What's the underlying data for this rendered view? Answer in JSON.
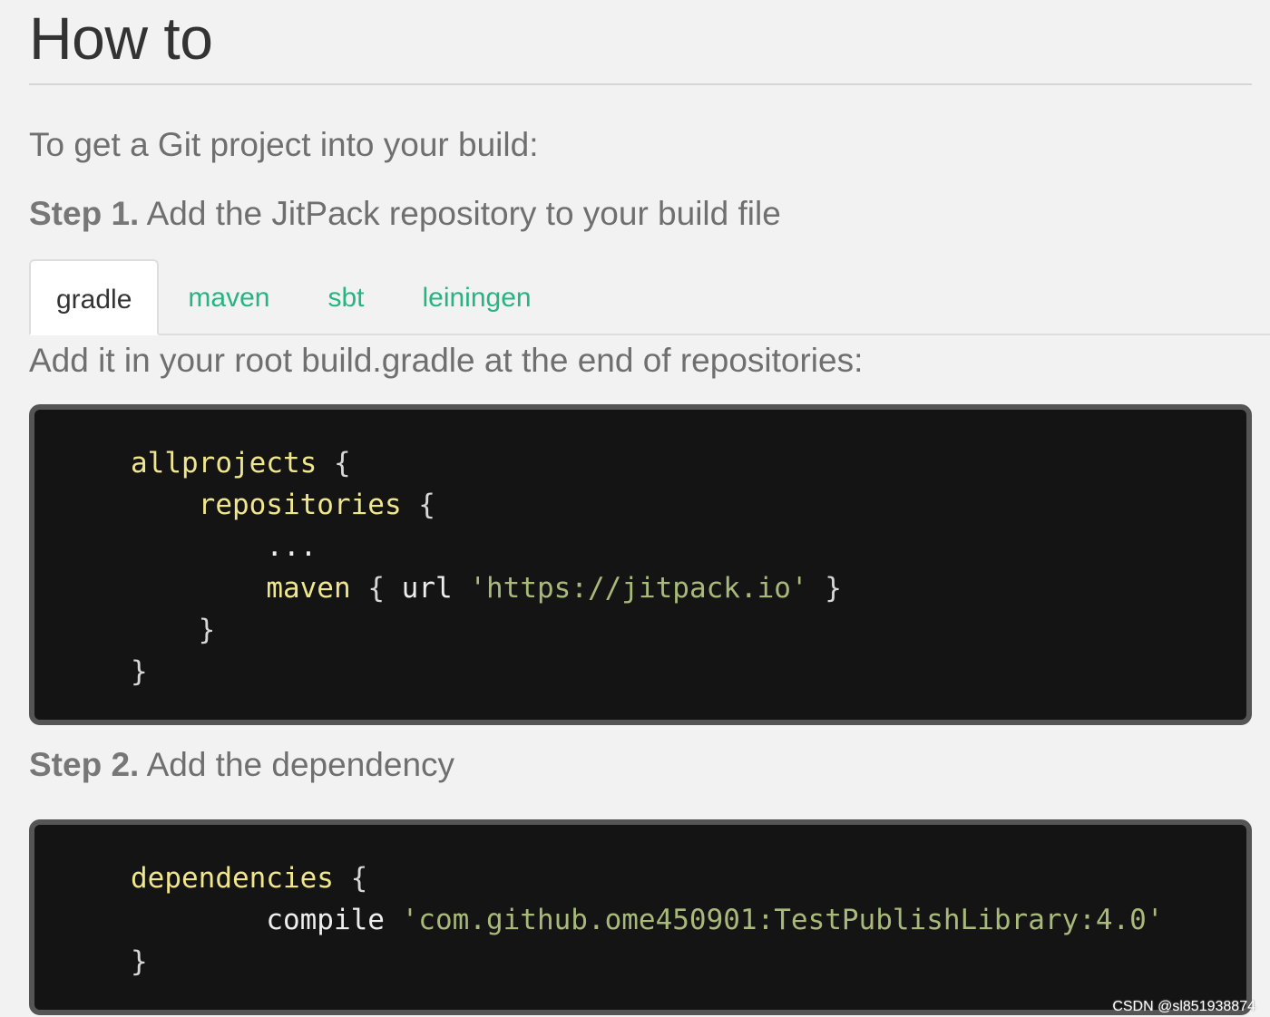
{
  "page": {
    "title": "How to",
    "intro": "To get a Git project into your build:"
  },
  "step1": {
    "label": "Step 1.",
    "text": " Add the JitPack repository to your build file"
  },
  "tabs": [
    {
      "label": "gradle",
      "active": true
    },
    {
      "label": "maven",
      "active": false
    },
    {
      "label": "sbt",
      "active": false
    },
    {
      "label": "leiningen",
      "active": false
    }
  ],
  "tab_description": "Add it in your root build.gradle at the end of repositories:",
  "code1": {
    "allprojects": "allprojects",
    "repositories": "repositories",
    "ellipsis": "...",
    "maven": "maven",
    "url": "url",
    "url_value": "'https://jitpack.io'",
    "open_brace": "{",
    "close_brace": "}"
  },
  "step2": {
    "label": "Step 2.",
    "text": " Add the dependency"
  },
  "code2": {
    "dependencies": "dependencies",
    "compile": "compile",
    "artifact": "'com.github.ome450901:TestPublishLibrary:4.0'",
    "open_brace": "{",
    "close_brace": "}"
  },
  "watermark": "CSDN @sl851938874",
  "colors": {
    "background": "#f2f2f2",
    "tab_link": "#28b383",
    "code_background": "#141414",
    "code_keyword": "#f0e68c",
    "code_string": "#a8b97a"
  }
}
